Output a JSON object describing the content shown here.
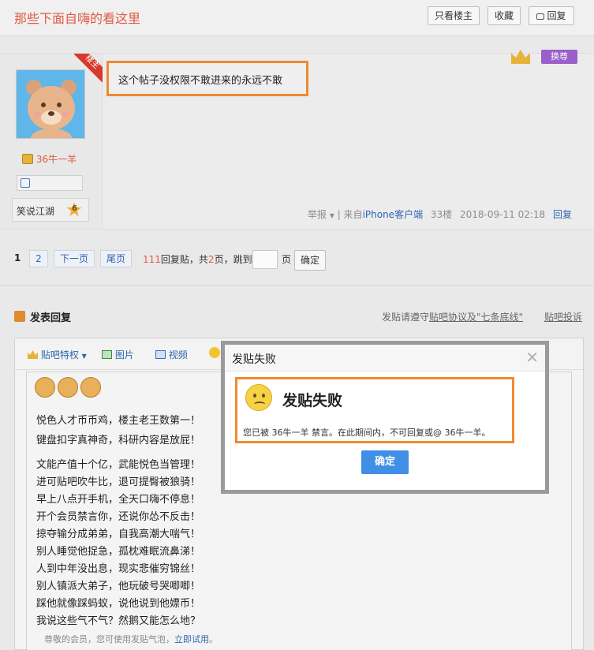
{
  "header": {
    "title": "那些下面自嗨的看这里",
    "btn_only_op": "只看楼主",
    "btn_favorite": "收藏",
    "btn_reply": "回复"
  },
  "post": {
    "op_tag": "楼主",
    "content": "这个帖子没权限不敢进来的永远不敢",
    "author_name": "36牛一羊",
    "level_title": "笑说江湖",
    "level_number": "6",
    "badge_text": "换尊",
    "meta": {
      "report": "举报",
      "from_prefix": "来自",
      "client": "iPhone客户端",
      "floor": "33楼",
      "time": "2018-09-11 02:18",
      "reply": "回复"
    }
  },
  "pager": {
    "current": "1",
    "page2": "2",
    "next": "下一页",
    "last": "尾页",
    "reply_count": "111",
    "reply_label": "回复贴，共",
    "total_pages": "2",
    "pages_label": "页，跳到",
    "page_unit": "页",
    "confirm": "确定"
  },
  "reply_section": {
    "title": "发表回复",
    "rules_prefix": "发贴请遵守",
    "rules_link": "贴吧协议及\"七条底线\"",
    "complaint": "贴吧投诉"
  },
  "toolbar": {
    "privilege": "贴吧特权",
    "image": "图片",
    "video": "视频"
  },
  "editor": {
    "lines": [
      "悦色人才币币鸡，楼主老王数第一！",
      "键盘扣字真神奇，科研内容是放屁！",
      "文能产值十个亿，武能悦色当管理！",
      "进可贴吧吹牛比，退可提臀被狼骑！",
      "早上八点开手机，全天口嗨不停息！",
      "开个会员禁言你，还说你怂不反击！",
      "掠夺输分成弟弟，自我高潮大喘气！",
      "别人睡觉他捉急，孤枕难眠流鼻涕！",
      "人到中年没出息，现实悲催穷锦丝！",
      "别人镇派大弟子，他玩破号哭唧唧！",
      "踩他就像踩蚂蚁，说他说到他嫖币！",
      "我说这些气不气？然鹅又能怎么地？"
    ],
    "footer_prefix": "尊敬的会员，您可使用发贴气泡，",
    "footer_link": "立即试用",
    "footer_suffix": "。"
  },
  "modal": {
    "title": "发贴失败",
    "heading": "发贴失败",
    "message": "您已被 36牛一羊 禁言。在此期间内，不可回复或@ 36牛一羊。",
    "confirm": "确定"
  },
  "colors": {
    "title_red": "#e05b44",
    "link_blue": "#2d64b3",
    "highlight_orange": "#f08a32",
    "confirm_blue": "#3f8fe6"
  }
}
